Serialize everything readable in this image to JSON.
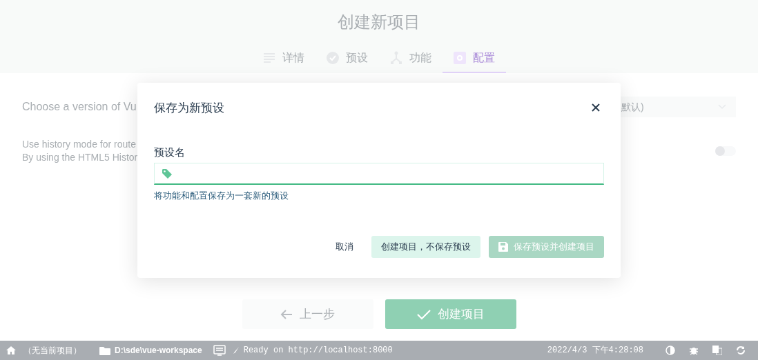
{
  "page": {
    "title": "创建新项目",
    "tabs": [
      {
        "label": "详情",
        "kind": "list",
        "selected": false
      },
      {
        "label": "预设",
        "kind": "check",
        "selected": false
      },
      {
        "label": "功能",
        "kind": "fork",
        "selected": false
      },
      {
        "label": "配置",
        "kind": "gear",
        "selected": true
      }
    ],
    "settings": [
      {
        "kind": "select",
        "label": "Choose a version of Vu",
        "value": "默认)"
      },
      {
        "kind": "toggle",
        "label": "Use history mode for route",
        "description": "By using the HTML5 Histor",
        "on": false
      }
    ],
    "buttons": [
      {
        "label": "上一步",
        "kind": "back"
      },
      {
        "label": "创建项目",
        "kind": "create"
      }
    ]
  },
  "dialog": {
    "title": "保存为新预设",
    "field_label": "预设名",
    "hint": "将功能和配置保存为一套新的预设",
    "buttons": [
      {
        "label": "取消",
        "kind": "flat",
        "disabled": false
      },
      {
        "label": "创建项目，不保存预设",
        "kind": "light",
        "disabled": false
      },
      {
        "label": "保存预设并创建项目",
        "kind": "primary",
        "disabled": true
      }
    ]
  },
  "status_bar": {
    "project": "（无当前项目）",
    "folder": "D:\\sde\\vue-workspace",
    "log": "Ready on http://localhost:8000",
    "time": "2022/4/3 下午4:28:08"
  }
}
